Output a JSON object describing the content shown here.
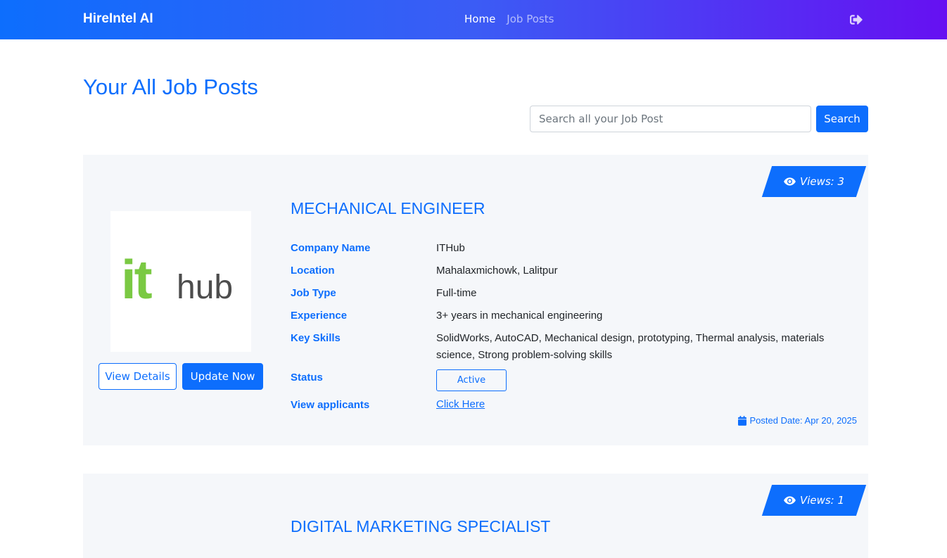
{
  "nav": {
    "brand": "HireIntel AI",
    "links": [
      "Home",
      "Job Posts"
    ],
    "logout_icon": "sign-out-icon"
  },
  "page": {
    "title": "Your All Job Posts"
  },
  "search": {
    "placeholder": "Search all your Job Post",
    "button_label": "Search"
  },
  "labels": {
    "company": "Company Name",
    "location": "Location",
    "job_type": "Job Type",
    "experience": "Experience",
    "skills": "Key Skills",
    "status": "Status",
    "applicants": "View applicants",
    "view_details": "View Details",
    "update_now": "Update Now"
  },
  "jobs": [
    {
      "views": "Views: 3",
      "title": "MECHANICAL ENGINEER",
      "logo_text_1": "it",
      "logo_text_2": "hub",
      "company": "ITHub",
      "location": "Mahalaxmichowk, Lalitpur",
      "job_type": "Full-time",
      "experience": "3+ years in mechanical engineering",
      "skills": "SolidWorks, AutoCAD, Mechanical design, prototyping, Thermal analysis, materials science, Strong problem-solving skills",
      "status": "Active",
      "applicants_link": "Click Here",
      "posted": "Posted Date: Apr 20, 2025"
    },
    {
      "views": "Views: 1",
      "title": "DIGITAL MARKETING SPECIALIST"
    }
  ],
  "colors": {
    "primary": "#0d6efd",
    "nav_gradient_end": "#6610f2",
    "card_bg": "#f5f7fa",
    "logo_green": "#7ac943",
    "logo_gray": "#4d4d4d"
  }
}
